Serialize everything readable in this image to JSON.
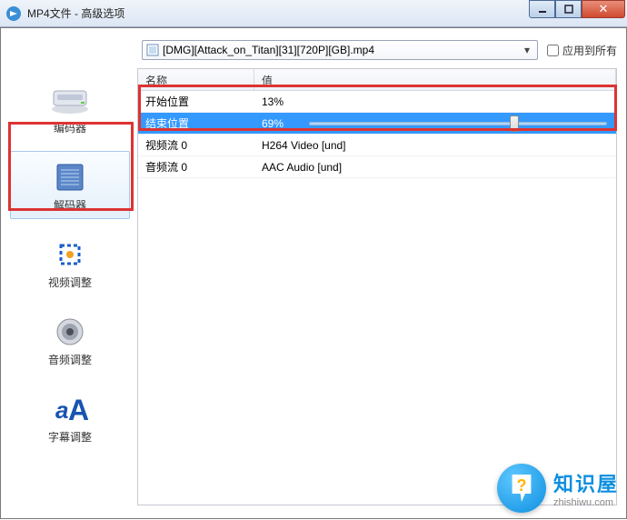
{
  "window": {
    "title": "MP4文件 - 高级选项"
  },
  "toolbar": {
    "file_label": "[DMG][Attack_on_Titan][31][720P][GB].mp4",
    "apply_all_label": "应用到所有"
  },
  "sidebar": {
    "items": [
      {
        "label": "编码器"
      },
      {
        "label": "解码器"
      },
      {
        "label": "视频调整"
      },
      {
        "label": "音频调整"
      },
      {
        "label": "字幕调整"
      }
    ],
    "selected_index": 1
  },
  "table": {
    "headers": {
      "name": "名称",
      "value": "值"
    },
    "rows": [
      {
        "name": "开始位置",
        "value": "13%"
      },
      {
        "name": "结束位置",
        "value": "69%"
      },
      {
        "name": "视频流 0",
        "value": "H264 Video [und]"
      },
      {
        "name": "音频流 0",
        "value": "AAC Audio [und]"
      }
    ],
    "selected_row_index": 1,
    "slider_percent": 69
  },
  "watermark": {
    "cn": "知识屋",
    "en": "zhishiwu.com",
    "q": "?"
  }
}
